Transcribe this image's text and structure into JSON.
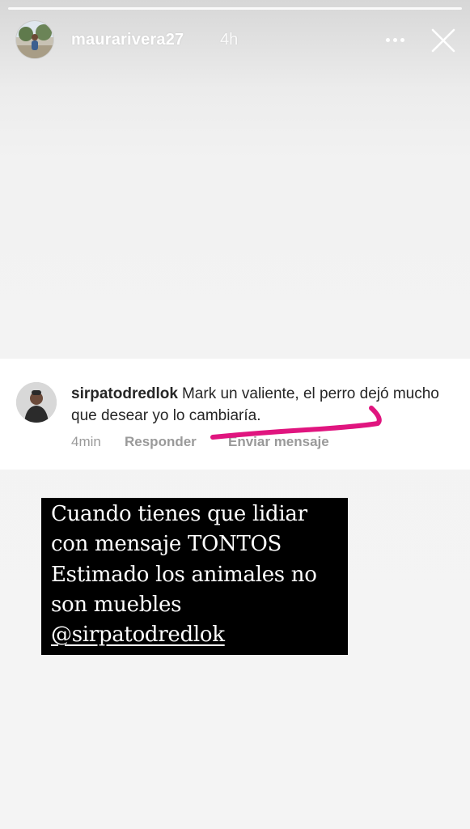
{
  "story": {
    "username": "maurarivera27",
    "time": "4h",
    "more_icon": "more-horizontal-icon",
    "close_icon": "close-icon"
  },
  "comment": {
    "username": "sirpatodredlok",
    "text": "Mark un valiente, el perro dejó mucho que desear yo lo cambiaría.",
    "time": "4min",
    "reply_label": "Responder",
    "send_label": "Enviar mensaje"
  },
  "caption": {
    "lines": [
      "Cuando tienes que lidiar",
      "con mensaje TONTOS",
      "Estimado los animales no",
      "son muebles",
      "@sirpatodredlok"
    ]
  },
  "colors": {
    "annotation": "#e0157f",
    "caption_bg": "#000000",
    "caption_text": "#ffffff"
  }
}
